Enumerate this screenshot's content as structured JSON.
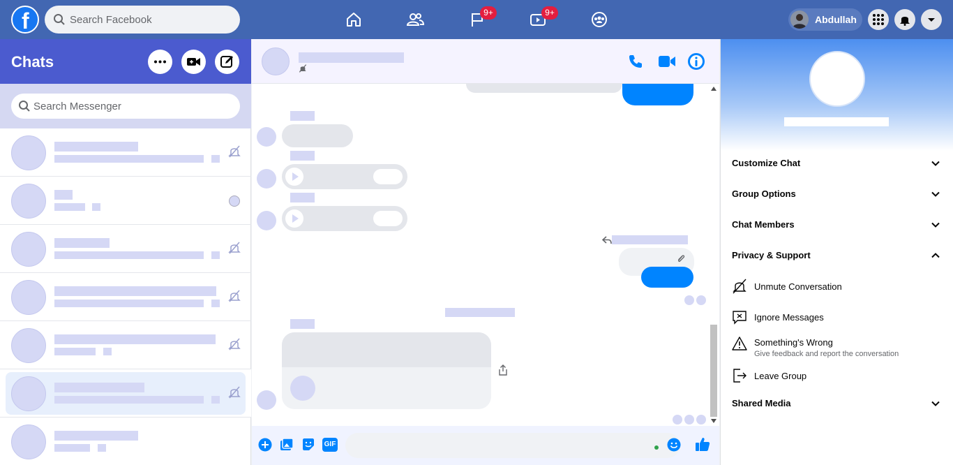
{
  "topbar": {
    "search_placeholder": "Search Facebook",
    "logo_letter": "f",
    "badges": {
      "pages": "9+",
      "watch": "9+"
    },
    "profile_name": "Abdullah"
  },
  "chats": {
    "title": "Chats",
    "search_placeholder": "Search Messenger",
    "items_count_note": ""
  },
  "info": {
    "sections": {
      "customize": "Customize Chat",
      "group_options": "Group Options",
      "members": "Chat Members",
      "privacy": "Privacy & Support",
      "shared_media": "Shared Media"
    },
    "privacy_items": {
      "unmute": "Unmute Conversation",
      "ignore": "Ignore Messages",
      "wrong": "Something's Wrong",
      "wrong_sub": "Give feedback and report the conversation",
      "leave": "Leave Group"
    }
  },
  "composer": {
    "gif_label": "GIF"
  },
  "colors": {
    "brand": "#4267b2",
    "messenger_blue": "#0084ff",
    "chats_header": "#4b5bcf",
    "placeholder": "#d5d8f5"
  }
}
